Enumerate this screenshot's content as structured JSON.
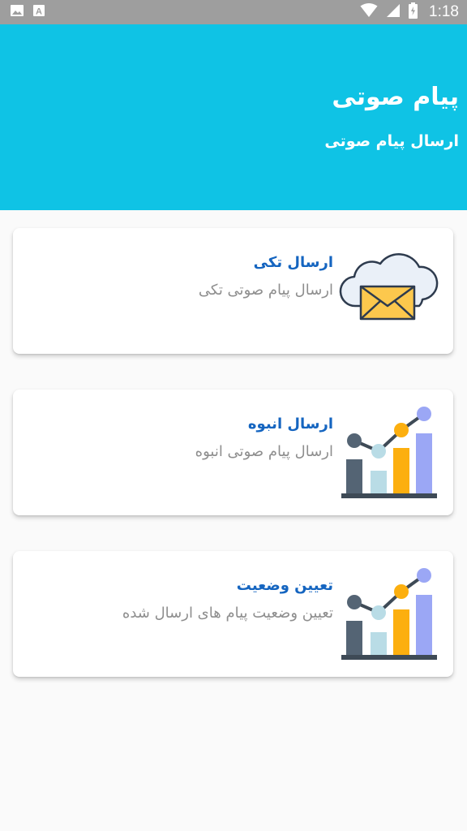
{
  "status_bar": {
    "time": "1:18",
    "left_icons": [
      "image-icon",
      "text-a-icon"
    ],
    "right_icons": [
      "wifi-icon",
      "signal-icon",
      "battery-icon"
    ]
  },
  "header": {
    "title": "پیام صوتی",
    "subtitle": "ارسال پیام صوتی",
    "background": "#0fc3e5"
  },
  "cards": [
    {
      "title": "ارسال تکی",
      "subtitle": "ارسال پیام صوتی تکی",
      "icon": "cloud-envelope-icon"
    },
    {
      "title": "ارسال انبوه",
      "subtitle": "ارسال پیام صوتی انبوه",
      "icon": "bar-chart-icon"
    },
    {
      "title": "تعیین وضعیت",
      "subtitle": "تعیین وضعیت پیام های ارسال شده",
      "icon": "bar-chart-icon"
    }
  ],
  "colors": {
    "accent": "#0fc3e5",
    "card_title": "#1565c0",
    "card_subtitle": "#8e8e8e",
    "status_bar": "#9e9e9e"
  }
}
